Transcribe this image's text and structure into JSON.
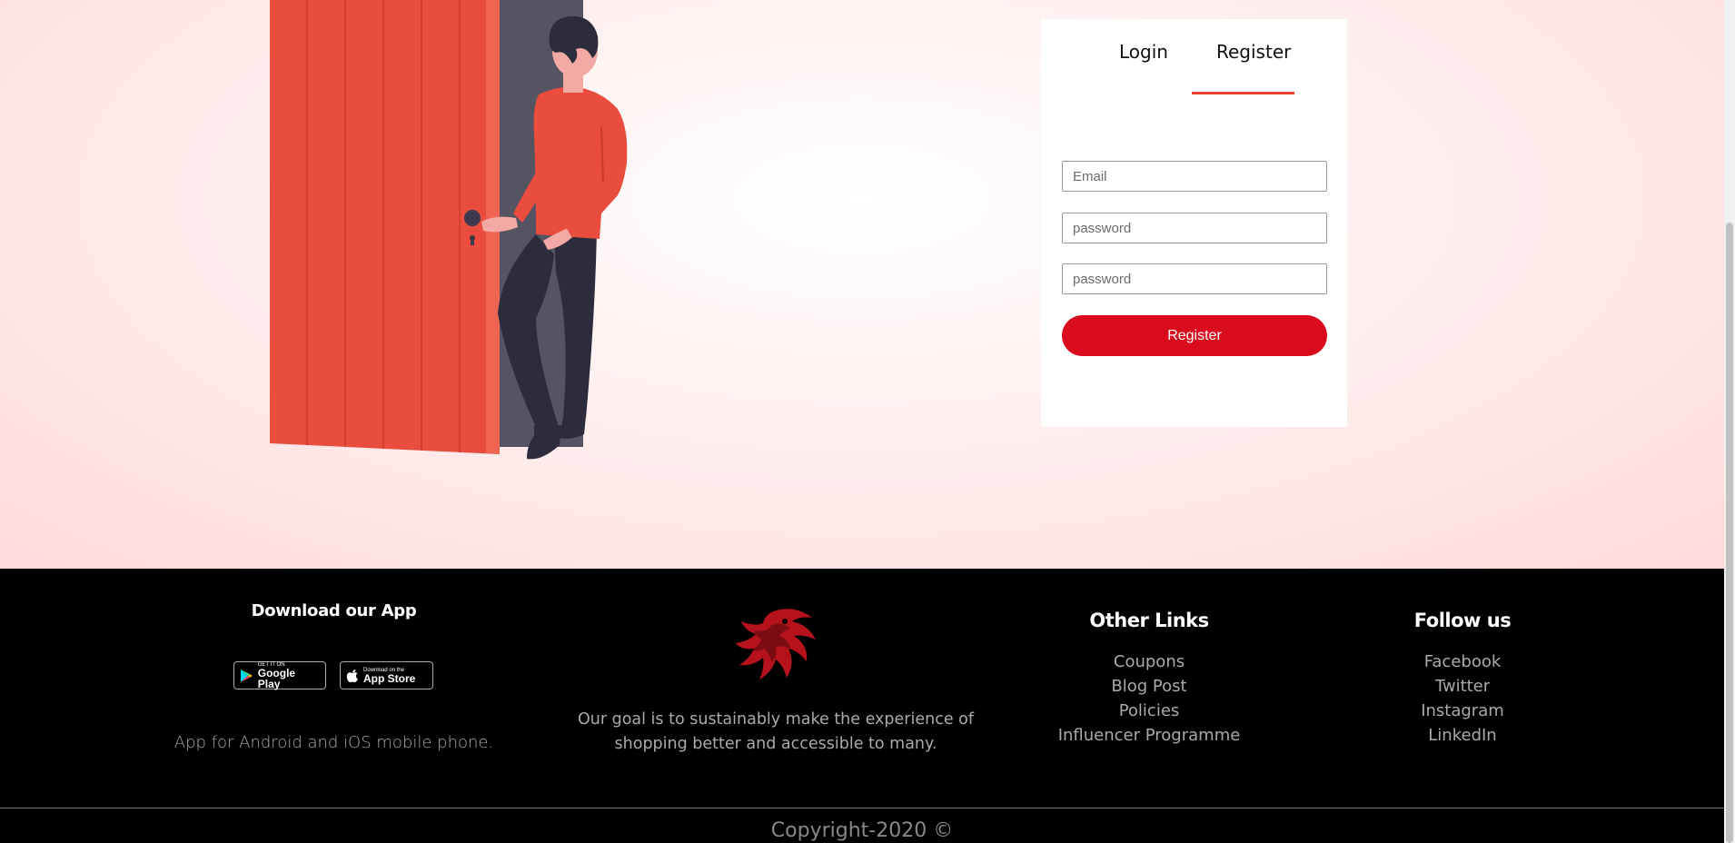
{
  "auth": {
    "tabs": [
      {
        "label": "Login"
      },
      {
        "label": "Register"
      }
    ],
    "active_tab": "Register",
    "fields": {
      "email_placeholder": "Email",
      "password_placeholder": "password",
      "confirm_password_placeholder": "password"
    },
    "submit_label": "Register"
  },
  "footer": {
    "app": {
      "title": "Download our App",
      "google_play": {
        "small": "GET IT ON",
        "big": "Google Play"
      },
      "app_store": {
        "small": "Download on the",
        "big": "App Store"
      },
      "description": "App for Android and iOS mobile phone."
    },
    "about": {
      "description": "Our goal is to sustainably make the experience of shopping better and accessible to many."
    },
    "other_links": {
      "title": "Other Links",
      "items": [
        "Coupons",
        "Blog Post",
        "Policies",
        "Influencer Programme"
      ]
    },
    "follow": {
      "title": "Follow us",
      "items": [
        "Facebook",
        "Twitter",
        "Instagram",
        "LinkedIn"
      ]
    },
    "copyright": "Copyright-2020 ©"
  },
  "colors": {
    "accent": "#e8432f",
    "button": "#db0b1e",
    "door": "#ea4c3d",
    "footer_bg": "#000000"
  },
  "icons": [
    "google-play-icon",
    "apple-icon",
    "phoenix-logo-icon"
  ]
}
